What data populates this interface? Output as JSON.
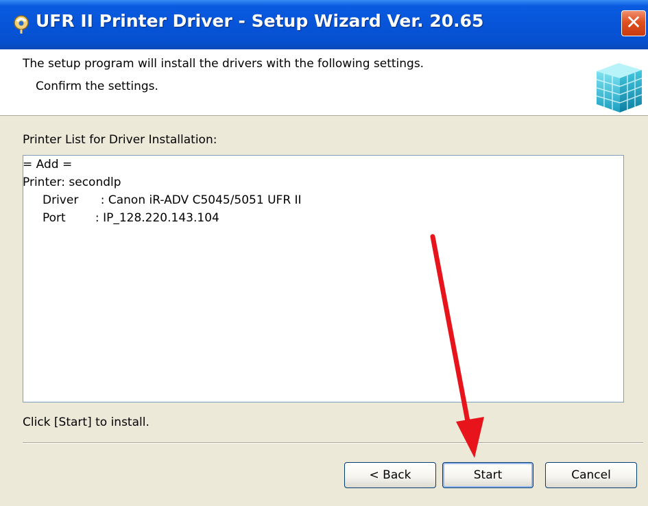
{
  "window": {
    "title": "UFR II Printer Driver - Setup Wizard Ver. 20.65",
    "close_symbol": "✕"
  },
  "header": {
    "line1": "The setup program will install the drivers with the following settings.",
    "line2": "Confirm the settings.",
    "icon": "setup-cube-icon"
  },
  "list": {
    "label": "Printer List for Driver Installation:",
    "lines": [
      "= Add =",
      "Printer: secondlp",
      "Driver      : Canon iR-ADV C5045/5051 UFR II",
      "Port        : IP_128.220.143.104"
    ]
  },
  "instruction": "Click [Start] to install.",
  "buttons": {
    "back": "< Back",
    "start": "Start",
    "cancel": "Cancel"
  },
  "annotation": {
    "arrow_color": "#e8141c"
  },
  "colors": {
    "titlebar": "#0754d8",
    "dialog_background": "#ece9d8",
    "close_button": "#e0501f"
  }
}
